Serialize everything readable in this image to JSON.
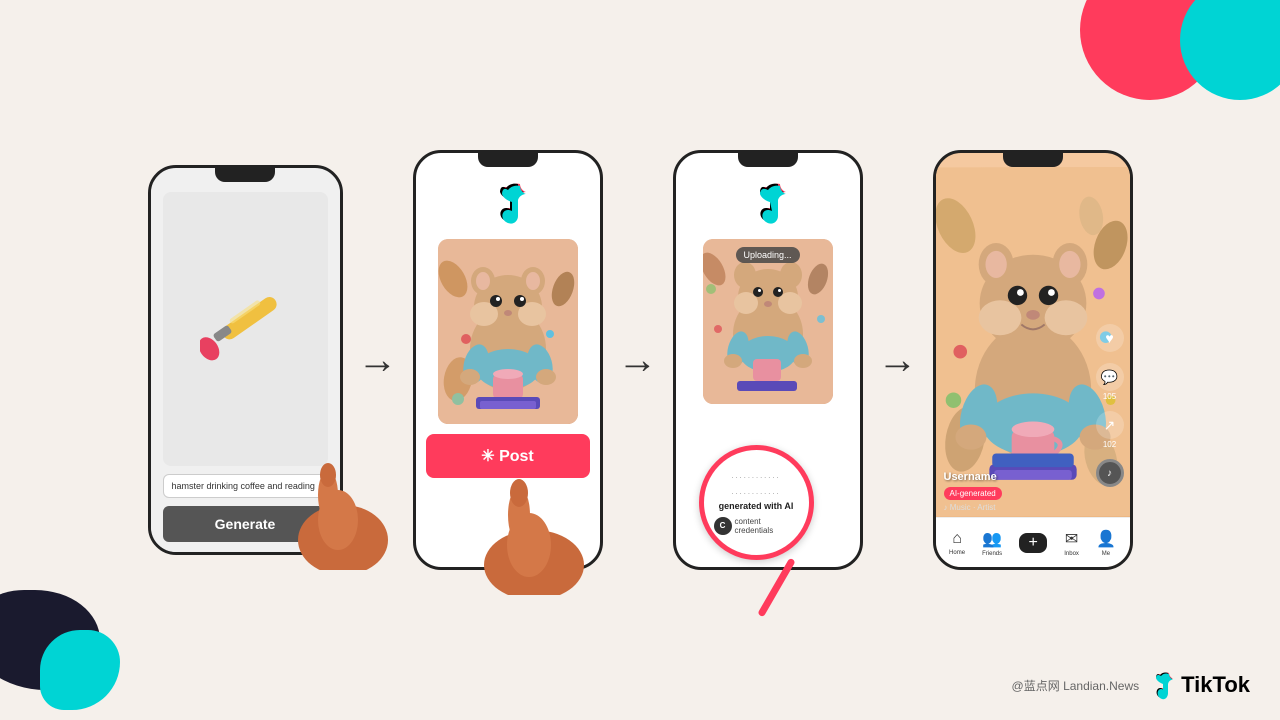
{
  "background": {
    "color": "#f5f0eb",
    "circles": [
      "pink",
      "cyan",
      "black",
      "cyan-small"
    ]
  },
  "flow": {
    "arrows": [
      "→",
      "→",
      "→"
    ],
    "steps": [
      {
        "id": "phone1",
        "type": "generate",
        "prompt_text": "hamster drinking coffee and reading",
        "generate_label": "Generate"
      },
      {
        "id": "phone2",
        "type": "post",
        "post_label": "✳ Post"
      },
      {
        "id": "phone3",
        "type": "upload",
        "uploading_label": "Uploading...",
        "ai_label": "generated with AI",
        "content_credentials_label": "content credentials"
      },
      {
        "id": "phone4",
        "type": "final",
        "username": "Username",
        "ai_badge": "AI-generated",
        "music": "♪ Music · Artist",
        "nav_items": [
          "Home",
          "Friends",
          "",
          "Inbox",
          "Me"
        ],
        "action_counts": [
          "",
          "105",
          "102"
        ]
      }
    ]
  },
  "watermark": {
    "site": "@蓝点网 Landian.News",
    "brand": "TikTok"
  },
  "tiktok_icon": "♪"
}
